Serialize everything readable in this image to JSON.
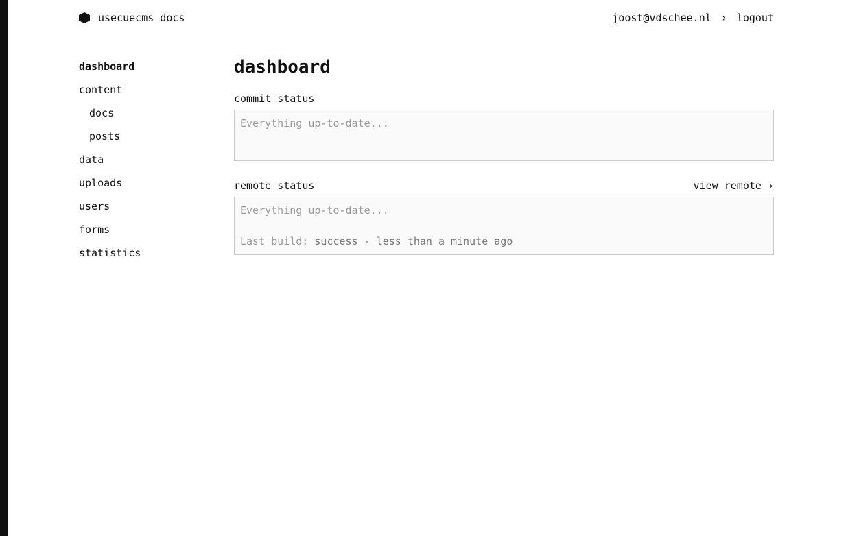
{
  "header": {
    "brand": "usecuecms docs",
    "user": "joost@vdschee.nl",
    "separator": "›",
    "logout": "logout"
  },
  "sidebar": {
    "items": [
      {
        "label": "dashboard",
        "active": true
      },
      {
        "label": "content"
      },
      {
        "label": "docs",
        "sub": true
      },
      {
        "label": "posts",
        "sub": true
      },
      {
        "label": "data"
      },
      {
        "label": "uploads"
      },
      {
        "label": "users"
      },
      {
        "label": "forms"
      },
      {
        "label": "statistics"
      }
    ]
  },
  "main": {
    "title": "dashboard",
    "commit": {
      "label": "commit status",
      "text": "Everything up-to-date..."
    },
    "remote": {
      "label": "remote status",
      "link": "view remote ›",
      "text": "Everything up-to-date...",
      "build_label": "Last build:",
      "build_value": "success - less than a minute ago"
    }
  }
}
